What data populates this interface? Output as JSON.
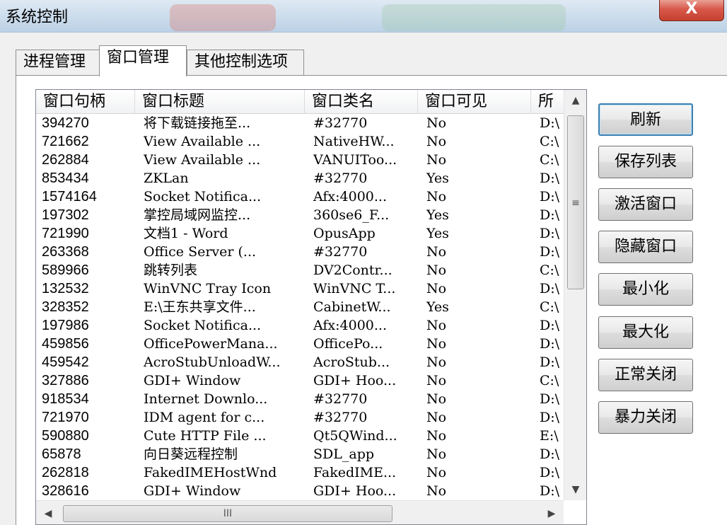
{
  "window": {
    "title": "系统控制",
    "close_glyph": "X"
  },
  "tabs": [
    {
      "label": "进程管理"
    },
    {
      "label": "窗口管理"
    },
    {
      "label": "其他控制选项"
    }
  ],
  "list": {
    "columns": [
      "窗口句柄",
      "窗口标题",
      "窗口类名",
      "窗口可见",
      "所"
    ],
    "rows": [
      [
        "394270",
        "将下载链接拖至...",
        "#32770",
        "No",
        "D:\\"
      ],
      [
        "721662",
        "View Available ...",
        "NativeHW...",
        "No",
        "C:\\"
      ],
      [
        "262884",
        "View Available ...",
        "VANUIToo...",
        "No",
        "C:\\"
      ],
      [
        "853434",
        "ZKLan",
        "#32770",
        "Yes",
        "D:\\"
      ],
      [
        "1574164",
        "Socket Notifica...",
        "Afx:4000...",
        "No",
        "D:\\"
      ],
      [
        "197302",
        "掌控局域网监控...",
        "360se6_F...",
        "Yes",
        "D:\\"
      ],
      [
        "721990",
        "文档1 - Word",
        "OpusApp",
        "Yes",
        "D:\\"
      ],
      [
        "263368",
        "Office Server (...",
        "#32770",
        "No",
        "D:\\"
      ],
      [
        "589966",
        "跳转列表",
        "DV2Contr...",
        "No",
        "C:\\"
      ],
      [
        "132532",
        "WinVNC Tray Icon",
        "WinVNC T...",
        "No",
        "D:\\"
      ],
      [
        "328352",
        "E:\\王东共享文件...",
        "CabinetW...",
        "Yes",
        "C:\\"
      ],
      [
        "197986",
        "Socket Notifica...",
        "Afx:4000...",
        "No",
        "D:\\"
      ],
      [
        "459856",
        "OfficePowerMana...",
        "OfficePo...",
        "No",
        "D:\\"
      ],
      [
        "459542",
        "AcroStubUnloadW...",
        "AcroStub...",
        "No",
        "D:\\"
      ],
      [
        "327886",
        "GDI+ Window",
        "GDI+ Hoo...",
        "No",
        "C:\\"
      ],
      [
        "918534",
        "Internet Downlo...",
        "#32770",
        "No",
        "D:\\"
      ],
      [
        "721970",
        "IDM agent for c...",
        "#32770",
        "No",
        "D:\\"
      ],
      [
        "590880",
        "Cute HTTP File ...",
        "Qt5QWind...",
        "No",
        "E:\\"
      ],
      [
        "65878",
        "向日葵远程控制",
        "SDL_app",
        "No",
        "D:\\"
      ],
      [
        "262818",
        "FakedIMEHostWnd",
        "FakedIME...",
        "No",
        "D:\\"
      ],
      [
        "328616",
        "GDI+ Window",
        "GDI+ Hoo...",
        "No",
        "D:\\"
      ]
    ]
  },
  "scrollbar": {
    "up": "▲",
    "down": "▼",
    "left": "◀",
    "right": "▶",
    "vgrip": "≡",
    "hgrip": "III"
  },
  "buttons": [
    {
      "label": "刷新"
    },
    {
      "label": "保存列表"
    },
    {
      "label": "激活窗口"
    },
    {
      "label": "隐藏窗口"
    },
    {
      "label": "最小化"
    },
    {
      "label": "最大化"
    },
    {
      "label": "正常关闭"
    },
    {
      "label": "暴力关闭"
    }
  ]
}
